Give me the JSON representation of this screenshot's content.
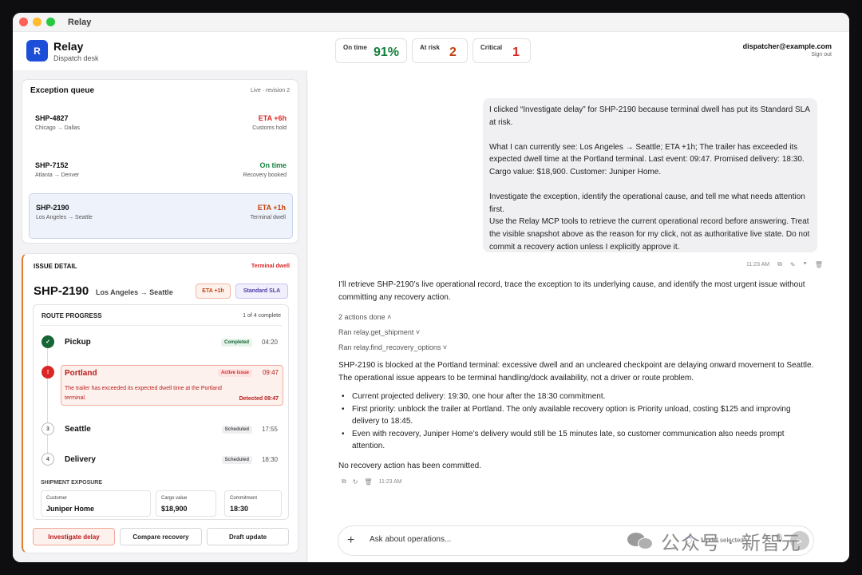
{
  "window": {
    "title": "Relay"
  },
  "brand": {
    "logo_letter": "R",
    "name": "Relay",
    "subtitle": "Dispatch desk",
    "accent": "#1d4ed8"
  },
  "kpis": [
    {
      "label": "On time",
      "value": "91%",
      "color": "#15803d"
    },
    {
      "label": "At risk",
      "value": "2",
      "color": "#c2410c"
    },
    {
      "label": "Critical",
      "value": "1",
      "color": "#dc2626"
    }
  ],
  "user": {
    "email": "dispatcher@example.com",
    "signout": "Sign out"
  },
  "queue": {
    "title": "Exception queue",
    "status": "Live · revision 2",
    "items": [
      {
        "id": "SHP-4827",
        "route": "Chicago → Dallas",
        "eta": "ETA +6h",
        "reason": "Customs hold",
        "color": "#dc2626"
      },
      {
        "id": "SHP-7152",
        "route": "Atlanta → Denver",
        "eta": "On time",
        "reason": "Recovery booked",
        "color": "#15803d"
      },
      {
        "id": "SHP-2190",
        "route": "Los Angeles → Seattle",
        "eta": "ETA +1h",
        "reason": "Terminal dwell",
        "color": "#c2410c"
      }
    ]
  },
  "issue": {
    "label": "ISSUE DETAIL",
    "tag": "Terminal dwell",
    "shipment_id": "SHP-2190",
    "route": "Los Angeles → Seattle",
    "eta_pill": "ETA +1h",
    "sla_pill": "Standard SLA",
    "route_progress": {
      "title": "ROUTE PROGRESS",
      "count": "1 of 4 complete",
      "stops": [
        {
          "name": "Pickup",
          "badge": "Completed",
          "time": "04:20",
          "marker": "✓"
        },
        {
          "name": "Portland",
          "badge": "Active issue",
          "time": "09:47",
          "marker": "!",
          "message": "The trailer has exceeded its expected dwell time at the Portland terminal.",
          "detected": "Detected 09:47"
        },
        {
          "name": "Seattle",
          "badge": "Scheduled",
          "time": "17:55",
          "marker": "3"
        },
        {
          "name": "Delivery",
          "badge": "Scheduled",
          "time": "18:30",
          "marker": "4"
        }
      ]
    },
    "exposure": {
      "title": "SHIPMENT EXPOSURE",
      "customer_label": "Customer",
      "customer": "Juniper Home",
      "cargo_label": "Cargo value",
      "cargo": "$18,900",
      "commit_label": "Commitment",
      "commit": "18:30"
    },
    "actions": [
      "Investigate delay",
      "Compare recovery",
      "Draft update"
    ]
  },
  "chat": {
    "user_message": [
      "I clicked “Investigate delay” for SHP-2190 because terminal dwell has put its Standard SLA at risk.",
      "What I can currently see: Los Angeles → Seattle; ETA +1h; The trailer has exceeded its expected dwell time at the Portland terminal. Last event: 09:47. Promised delivery: 18:30. Cargo value: $18,900. Customer: Juniper Home.",
      "Investigate the exception, identify the operational cause, and tell me what needs attention first.\nUse the Relay MCP tools to retrieve the current operational record before answering. Treat the visible snapshot above as the reason for my click, not as authoritative live state. Do not commit a recovery action unless I explicitly approve it."
    ],
    "user_time": "11:23 AM",
    "ai_intro": "I’ll retrieve SHP-2190’s live operational record, trace the exception to its underlying cause, and identify the most urgent issue without committing any recovery action.",
    "actions_done": "2 actions done",
    "tool_calls": [
      "Ran relay.get_shipment",
      "Ran relay.find_recovery_options"
    ],
    "ai_summary": "SHP-2190 is blocked at the Portland terminal: excessive dwell and an uncleared checkpoint are delaying onward movement to Seattle. The operational issue appears to be terminal handling/dock availability, not a driver or route problem.",
    "bullets": [
      "Current projected delivery: 19:30, one hour after the 18:30 commitment.",
      "First priority: unblock the trailer at Portland. The only available recovery option is Priority unload, costing $125 and improving delivery to 18:45.",
      "Even with recovery, Juniper Home’s delivery would still be 15 minutes late, so customer communication also needs prompt attention."
    ],
    "closing": "No recovery action has been committed.",
    "ai_time": "11:23 AM",
    "composer_placeholder": "Ask about operations...",
    "model_label": "Model selected"
  },
  "watermark": {
    "text": "公众号 · 新智元"
  }
}
